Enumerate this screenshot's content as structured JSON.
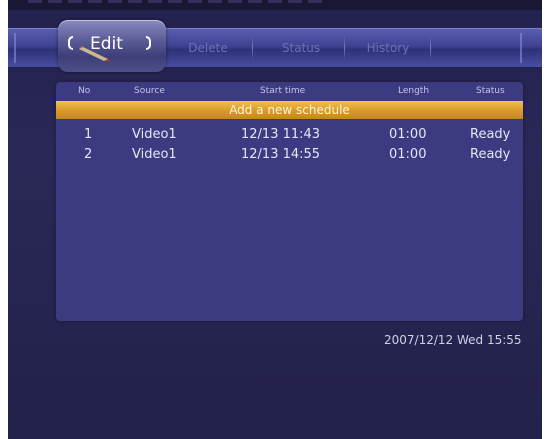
{
  "tabs": [
    {
      "label": "Edit",
      "active": true
    },
    {
      "label": "Delete",
      "active": false
    },
    {
      "label": "Status",
      "active": false
    },
    {
      "label": "History",
      "active": false
    }
  ],
  "table": {
    "columns": [
      "No",
      "Source",
      "Start time",
      "Length",
      "Status"
    ],
    "add_row_label": "Add a new schedule",
    "rows": [
      {
        "no": "1",
        "source": "Video1",
        "start_time": "12/13 11:43",
        "length": "01:00",
        "status": "Ready"
      },
      {
        "no": "2",
        "source": "Video1",
        "start_time": "12/13 14:55",
        "length": "01:00",
        "status": "Ready"
      }
    ]
  },
  "clock": "2007/12/12 Wed 15:55",
  "colors": {
    "background": "#23214e",
    "panel": "#3c3a81",
    "highlight": "#d8992a",
    "tab_bar": "#3e428f"
  },
  "icons": {
    "active_tab_icon": "pencil-icon"
  }
}
